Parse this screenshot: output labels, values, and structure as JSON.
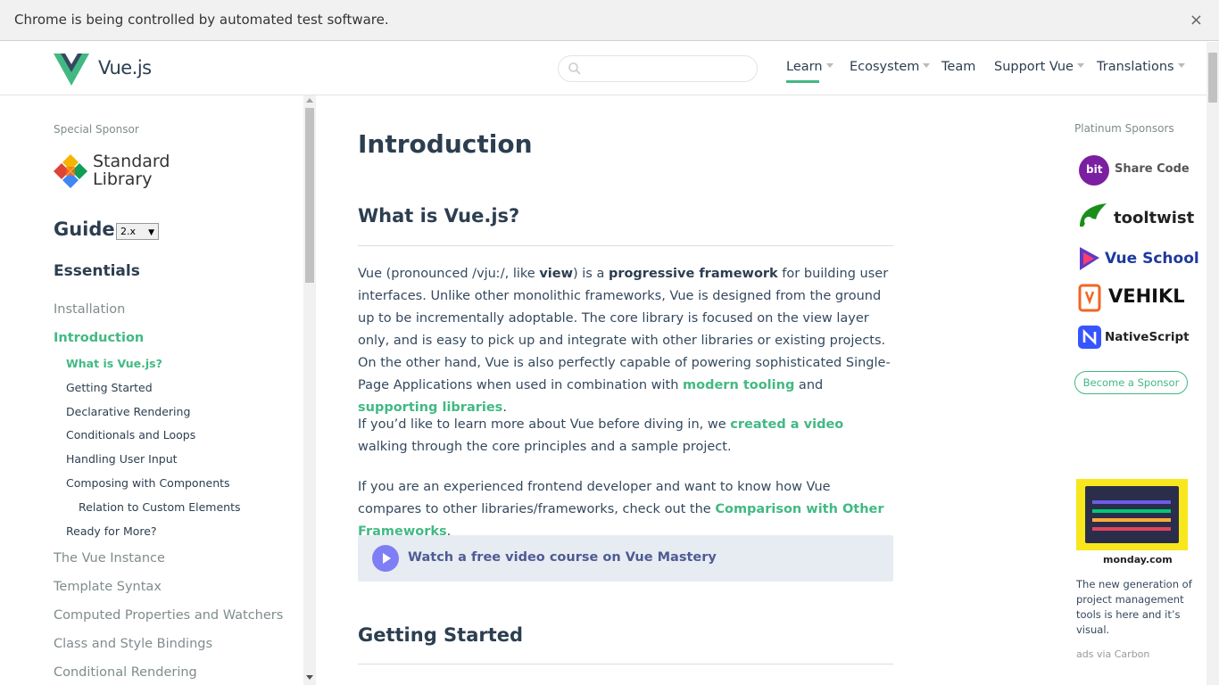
{
  "infobar": {
    "text": "Chrome is being controlled by automated test software.",
    "close": "×"
  },
  "header": {
    "logo_text": "Vue.js",
    "search_placeholder": "",
    "nav": {
      "learn": "Learn",
      "ecosystem": "Ecosystem",
      "team": "Team",
      "support": "Support Vue",
      "translations": "Translations"
    }
  },
  "sidebar": {
    "special_sponsor_label": "Special Sponsor",
    "sponsor_line1": "Standard",
    "sponsor_line2": "Library",
    "guide_title": "Guide",
    "version": "2.x",
    "section": "Essentials",
    "items": [
      {
        "label": "Installation"
      },
      {
        "label": "Introduction"
      },
      {
        "label": "The Vue Instance"
      },
      {
        "label": "Template Syntax"
      },
      {
        "label": "Computed Properties and Watchers"
      },
      {
        "label": "Class and Style Bindings"
      },
      {
        "label": "Conditional Rendering"
      }
    ],
    "sub_items": [
      {
        "label": "What is Vue.js?"
      },
      {
        "label": "Getting Started"
      },
      {
        "label": "Declarative Rendering"
      },
      {
        "label": "Conditionals and Loops"
      },
      {
        "label": "Handling User Input"
      },
      {
        "label": "Composing with Components"
      },
      {
        "label": "Relation to Custom Elements"
      },
      {
        "label": "Ready for More?"
      }
    ]
  },
  "main": {
    "title": "Introduction",
    "h2_what": "What is Vue.js?",
    "p1": {
      "t1": "Vue (pronounced /vjuː/, like ",
      "b1": "view",
      "t2": ") is a ",
      "b2": "progressive framework",
      "t3": " for building user interfaces. Unlike other monolithic frameworks, Vue is designed from the ground up to be incrementally adoptable. The core library is focused on the view layer only, and is easy to pick up and integrate with other libraries or existing projects. On the other hand, Vue is also perfectly capable of powering sophisticated Single-Page Applications when used in combination with ",
      "link1": "modern tooling",
      "t4": " and ",
      "link2": "supporting libraries",
      "t5": "."
    },
    "p2": {
      "t1": "If you’d like to learn more about Vue before diving in, we ",
      "link": "created a video",
      "t2": " walking through the core principles and a sample project."
    },
    "p3": {
      "t1": "If you are an experienced frontend developer and want to know how Vue compares to other libraries/frameworks, check out the ",
      "link": "Comparison with Other Frameworks",
      "t2": "."
    },
    "mastery": "Watch a free video course on Vue Mastery",
    "h2_getting_started": "Getting Started"
  },
  "right": {
    "platinum_label": "Platinum Sponsors",
    "sponsors": [
      {
        "name": "Share Code",
        "badge": "bit"
      },
      {
        "name": "tooltwist"
      },
      {
        "name": "Vue School"
      },
      {
        "name": "VEHIKL"
      },
      {
        "name": "NativeScript"
      }
    ],
    "become": "Become a Sponsor",
    "ad_brand": "monday.com",
    "ad_text": "The new generation of project management tools is here and it’s visual.",
    "ad_via": "ads via Carbon"
  },
  "colors": {
    "accent": "#42b983",
    "text": "#2c3e50",
    "mastery_bg": "#e7ecf3"
  }
}
